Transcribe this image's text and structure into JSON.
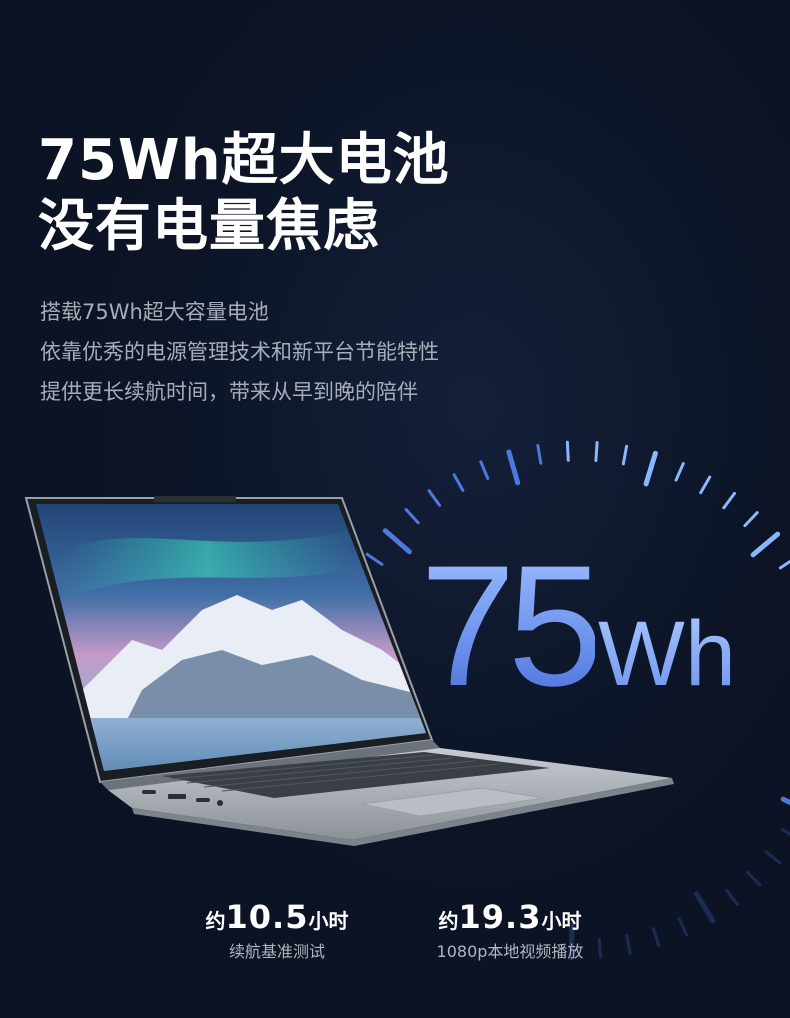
{
  "headline": {
    "line1": "75Wh超大电池",
    "line2": "没有电量焦虑"
  },
  "description": {
    "line1": "搭载75Wh超大容量电池",
    "line2": "依靠优秀的电源管理技术和新平台节能特性",
    "line3": "提供更长续航时间，带来从早到晚的陪伴"
  },
  "capacity_graphic": {
    "number": "75",
    "unit": "Wh"
  },
  "stats": [
    {
      "prefix": "约",
      "value": "10.5",
      "unit": "小时",
      "note": "续航基准测试"
    },
    {
      "prefix": "约",
      "value": "19.3",
      "unit": "小时",
      "note": "1080p本地视频播放"
    }
  ],
  "colors": {
    "background": "#0c1426",
    "accent_blue": "#6f95ee",
    "muted_text": "#a7adb8"
  }
}
